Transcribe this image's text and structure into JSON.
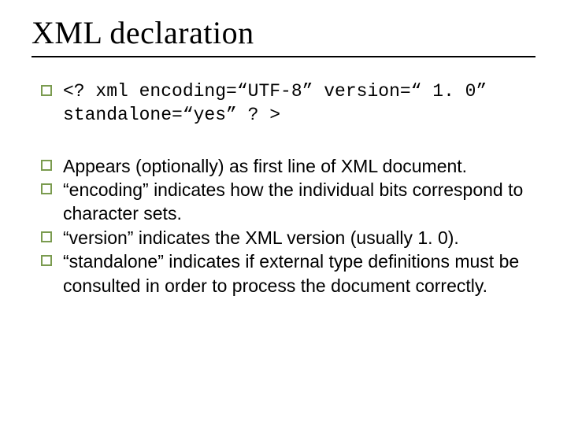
{
  "title": "XML declaration",
  "code_line": "<? xml encoding=“UTF-8” version=“ 1. 0” standalone=“yes” ? >",
  "bullets": [
    "Appears (optionally) as first line of XML document.",
    "“encoding” indicates how the individual bits correspond to character sets.",
    "“version” indicates the XML version (usually 1. 0).",
    "“standalone” indicates if external type definitions must be consulted in order to process the document correctly."
  ]
}
